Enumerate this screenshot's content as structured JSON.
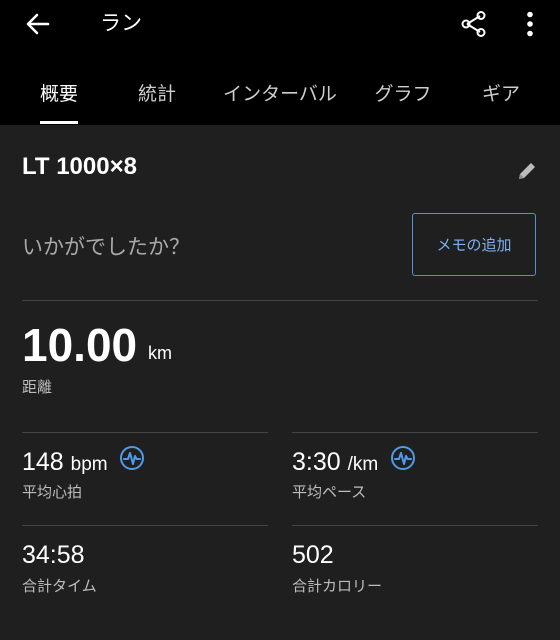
{
  "header": {
    "title": "ラン",
    "back_icon": "arrow-left-icon",
    "share_icon": "share-icon",
    "menu_icon": "more-vertical-icon"
  },
  "tabs": [
    {
      "label": "概要",
      "active": true
    },
    {
      "label": "統計",
      "active": false
    },
    {
      "label": "インターバル",
      "active": false
    },
    {
      "label": "グラフ",
      "active": false
    },
    {
      "label": "ギア",
      "active": false
    }
  ],
  "activity": {
    "name": "LT 1000×8",
    "edit_icon": "pencil-icon",
    "prompt": "いかがでしたか？",
    "memo_button": "メモの追加"
  },
  "distance": {
    "value": "10.00",
    "unit": "km",
    "label": "距離"
  },
  "stats": {
    "avg_hr": {
      "value": "148",
      "unit": "bpm",
      "label": "平均心拍"
    },
    "avg_pace": {
      "value": "3:30",
      "unit": "/km",
      "label": "平均ペース"
    },
    "total_time": {
      "value": "34:58",
      "label": "合計タイム"
    },
    "total_calories": {
      "value": "502",
      "label": "合計カロリー"
    }
  },
  "colors": {
    "background": "#1f1f1f",
    "topbar": "#000000",
    "accent": "#5a8ed6"
  }
}
